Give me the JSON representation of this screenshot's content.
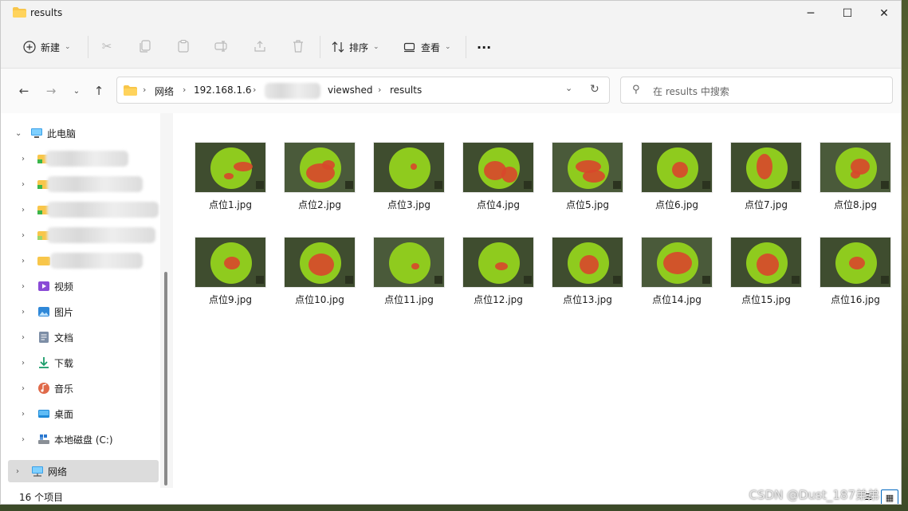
{
  "window": {
    "title": "results"
  },
  "window_controls": {
    "minimize": "─",
    "maximize": "☐",
    "close": "✕"
  },
  "toolbar": {
    "new_label": "新建",
    "sort_label": "排序",
    "view_label": "查看",
    "more_label": "···"
  },
  "breadcrumb": {
    "items": [
      "网络",
      "192.168.1.6",
      "viewshed",
      "results"
    ],
    "separator": "›"
  },
  "search": {
    "placeholder": "在 results 中搜索"
  },
  "sidebar": {
    "items": [
      {
        "label": "此电脑",
        "icon": "computer-icon"
      },
      {
        "label": "视频",
        "icon": "video-icon"
      },
      {
        "label": "图片",
        "icon": "pictures-icon"
      },
      {
        "label": "文档",
        "icon": "documents-icon"
      },
      {
        "label": "下载",
        "icon": "download-icon"
      },
      {
        "label": "音乐",
        "icon": "music-icon"
      },
      {
        "label": "桌面",
        "icon": "desktop-icon"
      },
      {
        "label": "本地磁盘 (C:)",
        "icon": "drive-icon"
      },
      {
        "label": "网络",
        "icon": "network-icon"
      }
    ]
  },
  "files": [
    {
      "name": "点位1.jpg"
    },
    {
      "name": "点位2.jpg"
    },
    {
      "name": "点位3.jpg"
    },
    {
      "name": "点位4.jpg"
    },
    {
      "name": "点位5.jpg"
    },
    {
      "name": "点位6.jpg"
    },
    {
      "name": "点位7.jpg"
    },
    {
      "name": "点位8.jpg"
    },
    {
      "name": "点位9.jpg"
    },
    {
      "name": "点位10.jpg"
    },
    {
      "name": "点位11.jpg"
    },
    {
      "name": "点位12.jpg"
    },
    {
      "name": "点位13.jpg"
    },
    {
      "name": "点位14.jpg"
    },
    {
      "name": "点位15.jpg"
    },
    {
      "name": "点位16.jpg"
    }
  ],
  "status": {
    "item_count": "16 个项目"
  },
  "watermark": "CSDN @Dust_187弟弟",
  "colors": {
    "accent": "#0067c0",
    "folder": "#f8c64a",
    "viewshed_green": "#8fcb1e",
    "viewshed_red": "#d8472b"
  }
}
